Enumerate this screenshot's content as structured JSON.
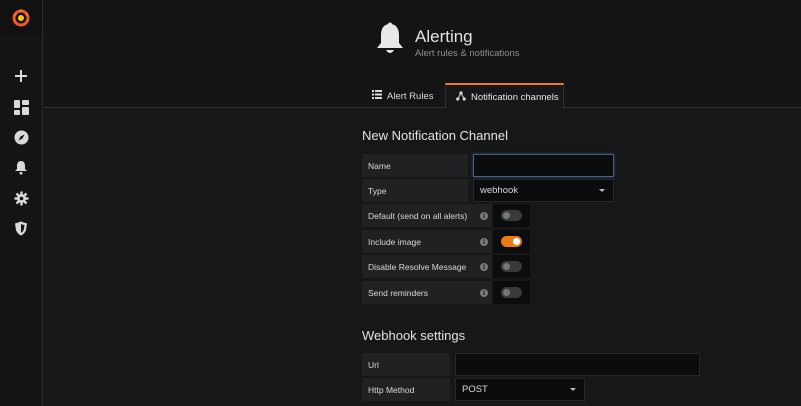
{
  "sidemenu": {
    "logo": "grafana-logo",
    "items": [
      {
        "name": "create",
        "icon": "plus-icon"
      },
      {
        "name": "dashboards",
        "icon": "grid-icon"
      },
      {
        "name": "explore",
        "icon": "compass-icon"
      },
      {
        "name": "alerting",
        "icon": "bell-icon"
      },
      {
        "name": "configuration",
        "icon": "gear-icon"
      },
      {
        "name": "server-admin",
        "icon": "shield-icon"
      }
    ]
  },
  "header": {
    "title": "Alerting",
    "subtitle": "Alert rules & notifications",
    "tabs": [
      {
        "label": "Alert Rules",
        "icon": "list-icon",
        "active": false
      },
      {
        "label": "Notification channels",
        "icon": "share-icon",
        "active": true
      }
    ]
  },
  "form": {
    "title": "New Notification Channel",
    "name": {
      "label": "Name",
      "value": ""
    },
    "type": {
      "label": "Type",
      "value": "webhook"
    },
    "switches": [
      {
        "label": "Default (send on all alerts)",
        "on": false
      },
      {
        "label": "Include image",
        "on": true
      },
      {
        "label": "Disable Resolve Message",
        "on": false
      },
      {
        "label": "Send reminders",
        "on": false
      }
    ]
  },
  "webhook": {
    "title": "Webhook settings",
    "url": {
      "label": "Url",
      "value": ""
    },
    "http_method": {
      "label": "Http Method",
      "value": "POST"
    }
  },
  "colors": {
    "accent": "#eb7b18",
    "background": "#161719",
    "panel": "#141414"
  }
}
